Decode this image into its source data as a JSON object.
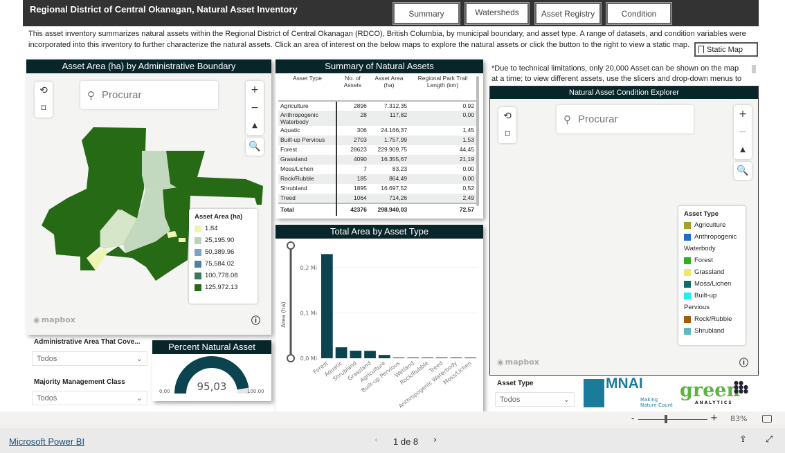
{
  "header": {
    "title": "Regional District of Central Okanagan, Natural Asset Inventory",
    "nav": [
      "Summary",
      "Watersheds",
      "Asset Registry",
      "Condition"
    ]
  },
  "description": "This asset inventory summarizes natural assets within the Regional District of Central Okanagan (RDCO), British Columbia, by municipal boundary, and asset type. A range of datasets, and condition variables were incorporated into this inventory to further characterize the natural assets. Click an area of interest on the below maps to explore the natural assets or click the button to the right to view a static map.",
  "static_map_label": "Static Map",
  "left_map": {
    "title": "Asset Area (ha) by Administrative Boundary",
    "search_placeholder": "Procurar",
    "legend_title": "Asset Area (ha)",
    "legend": [
      {
        "label": "1.84",
        "color": "#eef5b0"
      },
      {
        "label": "25,195.90",
        "color": "#b7d3bb"
      },
      {
        "label": "50,389.96",
        "color": "#7aa6c6"
      },
      {
        "label": "75,584.02",
        "color": "#4a84a0"
      },
      {
        "label": "100,778.08",
        "color": "#3a7a5c"
      },
      {
        "label": "125,972.13",
        "color": "#266a16"
      }
    ],
    "attribution": "mapbox"
  },
  "summary": {
    "title": "Summary of Natural Assets",
    "columns": [
      "Asset Type",
      "No. of Assets",
      "Asset Area (ha)",
      "Regional Park Trail Length (km)"
    ],
    "rows": [
      [
        "Agriculture",
        "2896",
        "7.312,35",
        "0,92"
      ],
      [
        "Anthropogenic Waterbody",
        "28",
        "117,82",
        "0,00"
      ],
      [
        "Aquatic",
        "306",
        "24.166,37",
        "1,45"
      ],
      [
        "Built-up Pervious",
        "2703",
        "1.757,99",
        "1,53"
      ],
      [
        "Forest",
        "28623",
        "229.909,75",
        "44,45"
      ],
      [
        "Grassland",
        "4090",
        "16.355,67",
        "21,19"
      ],
      [
        "Moss/Lichen",
        "7",
        "83,23",
        "0,00"
      ],
      [
        "Rock/Rubble",
        "185",
        "864,49",
        "0,00"
      ],
      [
        "Shrubland",
        "1895",
        "16.697,52",
        "0,52"
      ],
      [
        "Treed",
        "1064",
        "714,26",
        "2,49"
      ]
    ],
    "total": [
      "Total",
      "42376",
      "298.940,03",
      "72,57"
    ]
  },
  "chart_data": {
    "type": "bar",
    "title": "Total Area by Asset Type",
    "ylabel": "Area (ha)",
    "xlabel": "",
    "ylim": [
      0,
      250000
    ],
    "yticks": [
      {
        "v": 0,
        "label": "0,0 Mi"
      },
      {
        "v": 100000,
        "label": "0,1 Mi"
      },
      {
        "v": 200000,
        "label": "0,2 Mi"
      }
    ],
    "categories": [
      "Forest",
      "Aquatic",
      "Shrubland",
      "Grassland",
      "Agriculture",
      "Built-up Pervious",
      "Wetland",
      "Rock/Rubble",
      "Treed",
      "Anthropogenic Waterbody",
      "Moss/Lichen"
    ],
    "values": [
      229909.75,
      24166.37,
      16697.52,
      16355.67,
      7312.35,
      1757.99,
      1000,
      864.49,
      714.26,
      117.82,
      83.23
    ],
    "color": "#0b434e",
    "grid": true
  },
  "slicers": {
    "admin_label": "Administrative Area That Cove...",
    "admin_value": "Todos",
    "mgmt_label": "Majority Management Class",
    "mgmt_value": "Todos",
    "asset_label": "Asset Type",
    "asset_value": "Todos"
  },
  "gauge": {
    "title": "Percent Natural Asset",
    "value": 95.03,
    "value_label": "95,03",
    "min_label": "0,00",
    "max_label": "100,00",
    "color": "#0b434e"
  },
  "note": "*Due to technical limitations, only 20,000 Asset can be shown on the map at a time; to view different assets, use the slicers and drop-down menus to",
  "right_map": {
    "title": "Natural Asset Condition Explorer",
    "search_placeholder": "Procurar",
    "legend_title": "Asset Type",
    "legend": [
      {
        "label": "Agriculture",
        "color": "#a0a232"
      },
      {
        "label": "Anthropogenic",
        "color": "#1f6ccf"
      },
      {
        "label": "Waterbody",
        "color": ""
      },
      {
        "label": "Forest",
        "color": "#2bb31f"
      },
      {
        "label": "Grassland",
        "color": "#ece86c"
      },
      {
        "label": "Moss/Lichen",
        "color": "#0b6e6a"
      },
      {
        "label": "Built-up",
        "color": "#1ef0f0"
      },
      {
        "label": "Pervious",
        "color": ""
      },
      {
        "label": "Rock/Rubble",
        "color": "#9b5e0a"
      },
      {
        "label": "Shrubland",
        "color": "#62b9bb"
      }
    ],
    "attribution": "mapbox"
  },
  "logos": {
    "mnai": "MNAI",
    "mnai_sub": "Making Nature Count",
    "green": "green",
    "green_sub": "ANALYTICS"
  },
  "zoom": {
    "value": "83%",
    "level": 0.5
  },
  "footer": {
    "brand": "Microsoft Power BI",
    "page": "1 de 8"
  }
}
